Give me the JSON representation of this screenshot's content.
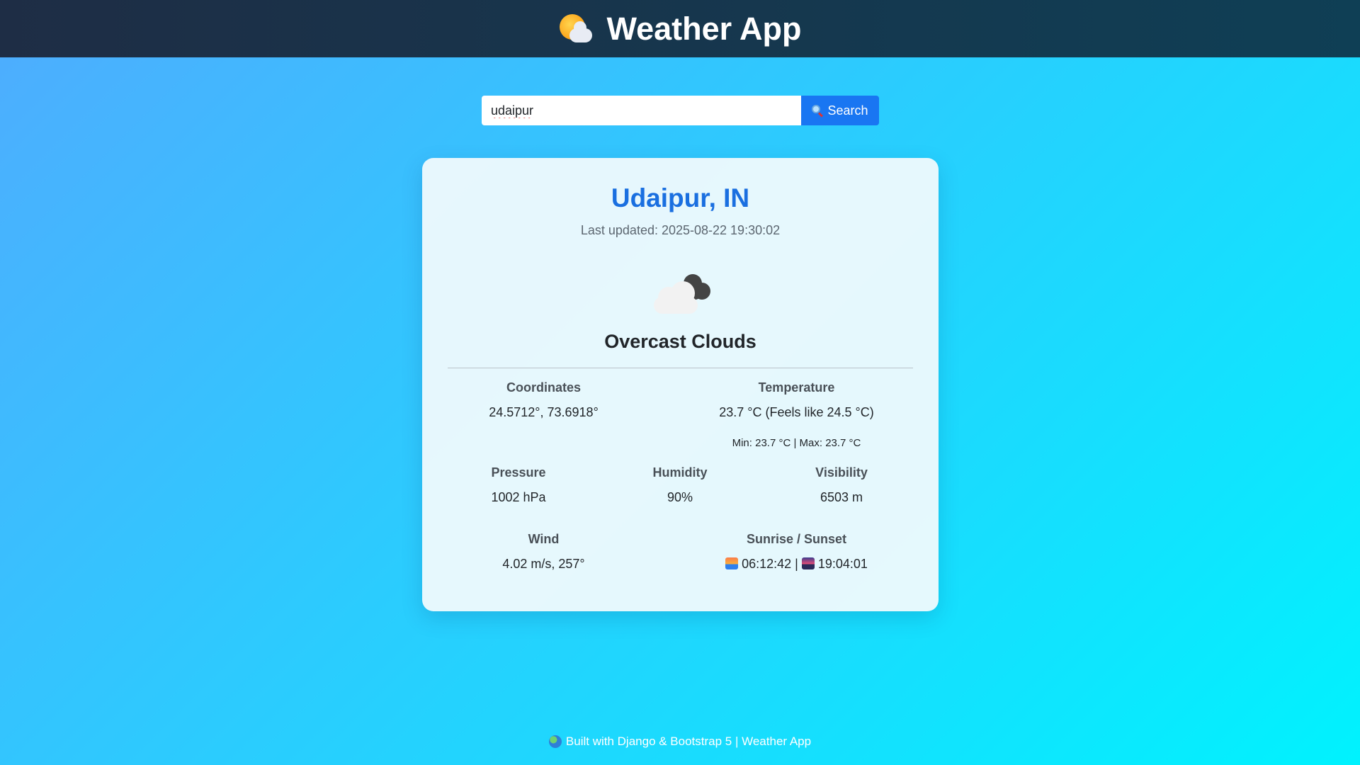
{
  "header": {
    "title": "Weather App",
    "icon": "sun-behind-cloud-icon"
  },
  "search": {
    "value": "udaipur",
    "button_label": "Search",
    "button_icon": "magnifier-icon"
  },
  "weather": {
    "location": "Udaipur, IN",
    "last_updated": "Last updated: 2025-08-22 19:30:02",
    "condition_icon": "overcast-clouds-icon",
    "description": "Overcast Clouds",
    "coordinates": {
      "label": "Coordinates",
      "value": "24.5712°, 73.6918°"
    },
    "temperature": {
      "label": "Temperature",
      "value": "23.7 °C (Feels like 24.5 °C)",
      "minmax": "Min: 23.7 °C | Max: 23.7 °C"
    },
    "pressure": {
      "label": "Pressure",
      "value": "1002 hPa"
    },
    "humidity": {
      "label": "Humidity",
      "value": "90%"
    },
    "visibility": {
      "label": "Visibility",
      "value": "6503 m"
    },
    "wind": {
      "label": "Wind",
      "value": "4.02 m/s, 257°"
    },
    "sun": {
      "label": "Sunrise / Sunset",
      "sunrise": "06:12:42",
      "separator": "|",
      "sunset": "19:04:01"
    }
  },
  "footer": {
    "text": "Built with Django & Bootstrap 5 | Weather App",
    "icon": "globe-icon"
  },
  "colors": {
    "accent": "#1a6fe0",
    "button": "#1976f2",
    "navbar": "#1e2d45"
  }
}
